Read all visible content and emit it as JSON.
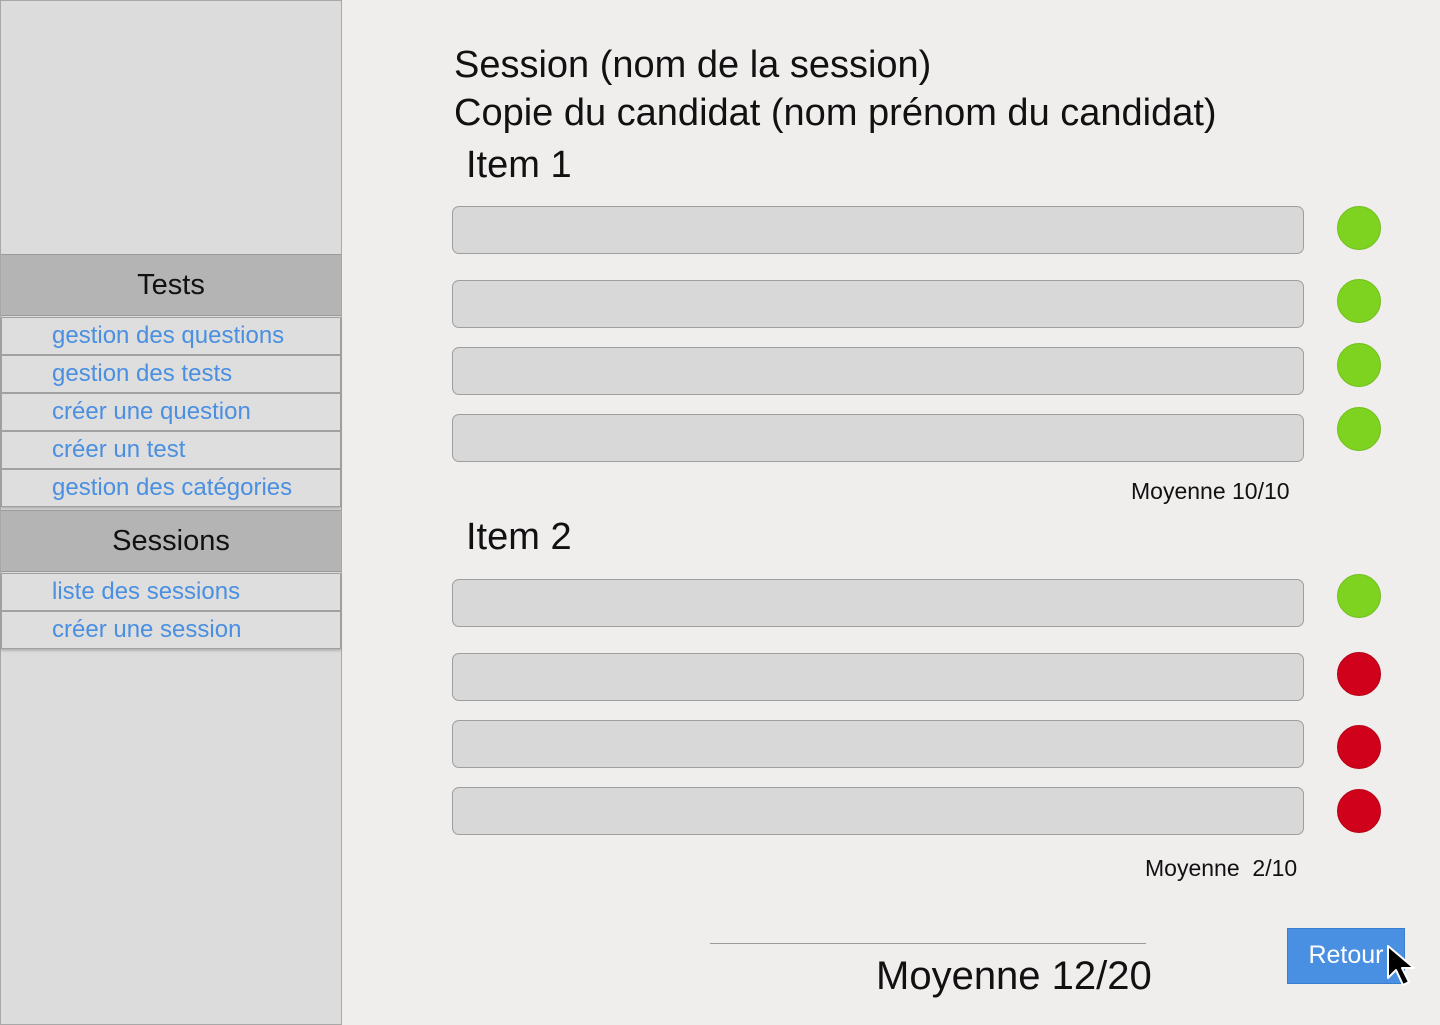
{
  "sidebar": {
    "tests_header": "Tests",
    "tests_items": [
      "gestion des questions",
      "gestion des tests",
      "créer une question",
      "créer un test",
      "gestion des catégories"
    ],
    "sessions_header": "Sessions",
    "sessions_items": [
      "liste des sessions",
      "créer une session"
    ]
  },
  "header": {
    "session_line": "Session (nom de la session)",
    "candidate_line": "Copie du candidat (nom prénom du candidat)"
  },
  "items": [
    {
      "title": "Item 1",
      "answers": [
        "correct",
        "correct",
        "correct",
        "correct"
      ],
      "average": "Moyenne 10/10"
    },
    {
      "title": "Item 2",
      "answers": [
        "correct",
        "incorrect",
        "incorrect",
        "incorrect"
      ],
      "average": "Moyenne  2/10"
    }
  ],
  "total_average": "Moyenne 12/20",
  "actions": {
    "back_label": "Retour"
  },
  "colors": {
    "correct": "#7ed321",
    "incorrect": "#d0021b",
    "accent": "#4a90e2",
    "link": "#4a8fe0"
  },
  "icons": {
    "cursor": "cursor-arrow-icon"
  }
}
